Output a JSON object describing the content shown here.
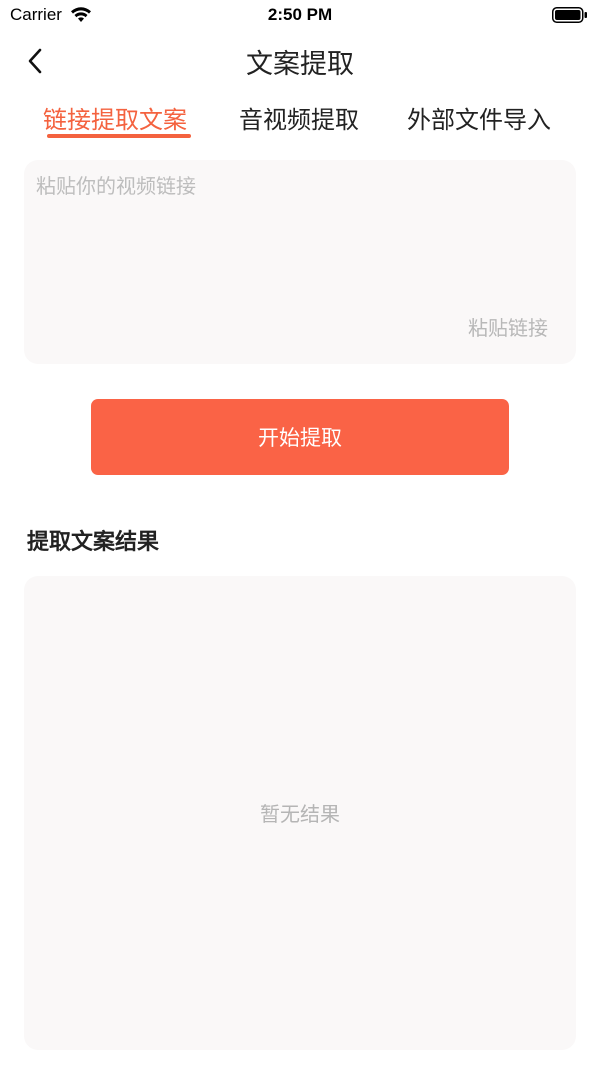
{
  "status_bar": {
    "carrier": "Carrier",
    "time": "2:50 PM",
    "wifi_icon": "wifi-icon",
    "battery_icon": "battery-icon"
  },
  "nav": {
    "title": "文案提取",
    "back_icon": "chevron-left-icon"
  },
  "tabs": [
    {
      "label": "链接提取文案",
      "active": true
    },
    {
      "label": "音视频提取",
      "active": false
    },
    {
      "label": "外部文件导入",
      "active": false
    }
  ],
  "link_input": {
    "placeholder": "粘贴你的视频链接",
    "value": "",
    "paste_label": "粘贴链接"
  },
  "start_button": {
    "label": "开始提取"
  },
  "result": {
    "heading": "提取文案结果",
    "empty_text": "暂无结果"
  },
  "colors": {
    "accent": "#f4623f",
    "button": "#fa6346",
    "card_bg": "#faf8f8"
  }
}
